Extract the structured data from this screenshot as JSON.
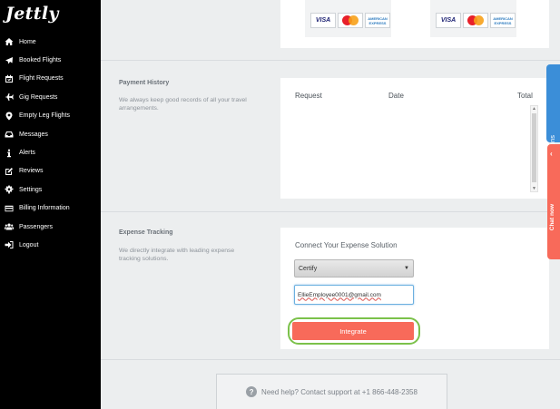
{
  "brand": {
    "logo_text": "Jettly"
  },
  "sidebar": {
    "items": [
      {
        "label": "Home",
        "icon": "home-icon"
      },
      {
        "label": "Booked Flights",
        "icon": "plane-icon"
      },
      {
        "label": "Flight Requests",
        "icon": "calendar-check-icon"
      },
      {
        "label": "Gig Requests",
        "icon": "plane-side-icon"
      },
      {
        "label": "Empty Leg Flights",
        "icon": "map-pin-icon"
      },
      {
        "label": "Messages",
        "icon": "inbox-icon"
      },
      {
        "label": "Alerts",
        "icon": "info-icon"
      },
      {
        "label": "Reviews",
        "icon": "edit-icon"
      },
      {
        "label": "Settings",
        "icon": "gear-icon"
      },
      {
        "label": "Billing Information",
        "icon": "credit-card-icon"
      },
      {
        "label": "Passengers",
        "icon": "users-icon"
      },
      {
        "label": "Logout",
        "icon": "sign-out-icon"
      }
    ]
  },
  "cards": {
    "visa": "VISA",
    "amex_line1": "AMERICAN",
    "amex_line2": "EXPRESS"
  },
  "payment_history": {
    "title": "Payment History",
    "description": "We always keep good records of all your travel arrangements.",
    "columns": {
      "request": "Request",
      "date": "Date",
      "total": "Total"
    }
  },
  "expense_tracking": {
    "title": "Expense Tracking",
    "description": "We directly integrate with leading expense tracking solutions.",
    "connect_title": "Connect Your Expense Solution",
    "selected_solution": "Certify",
    "email_value": "EllieEmployee0001@gmail.com",
    "integrate_label": "Integrate"
  },
  "help": {
    "text": "Need help? Contact support at +1 866-448-2358"
  },
  "side_tabs": {
    "notifications": "Get Notifications",
    "chat": "Chat now"
  },
  "colors": {
    "accent": "#f86a5a",
    "notify": "#3b8ed8",
    "highlight": "#7bc14a"
  }
}
